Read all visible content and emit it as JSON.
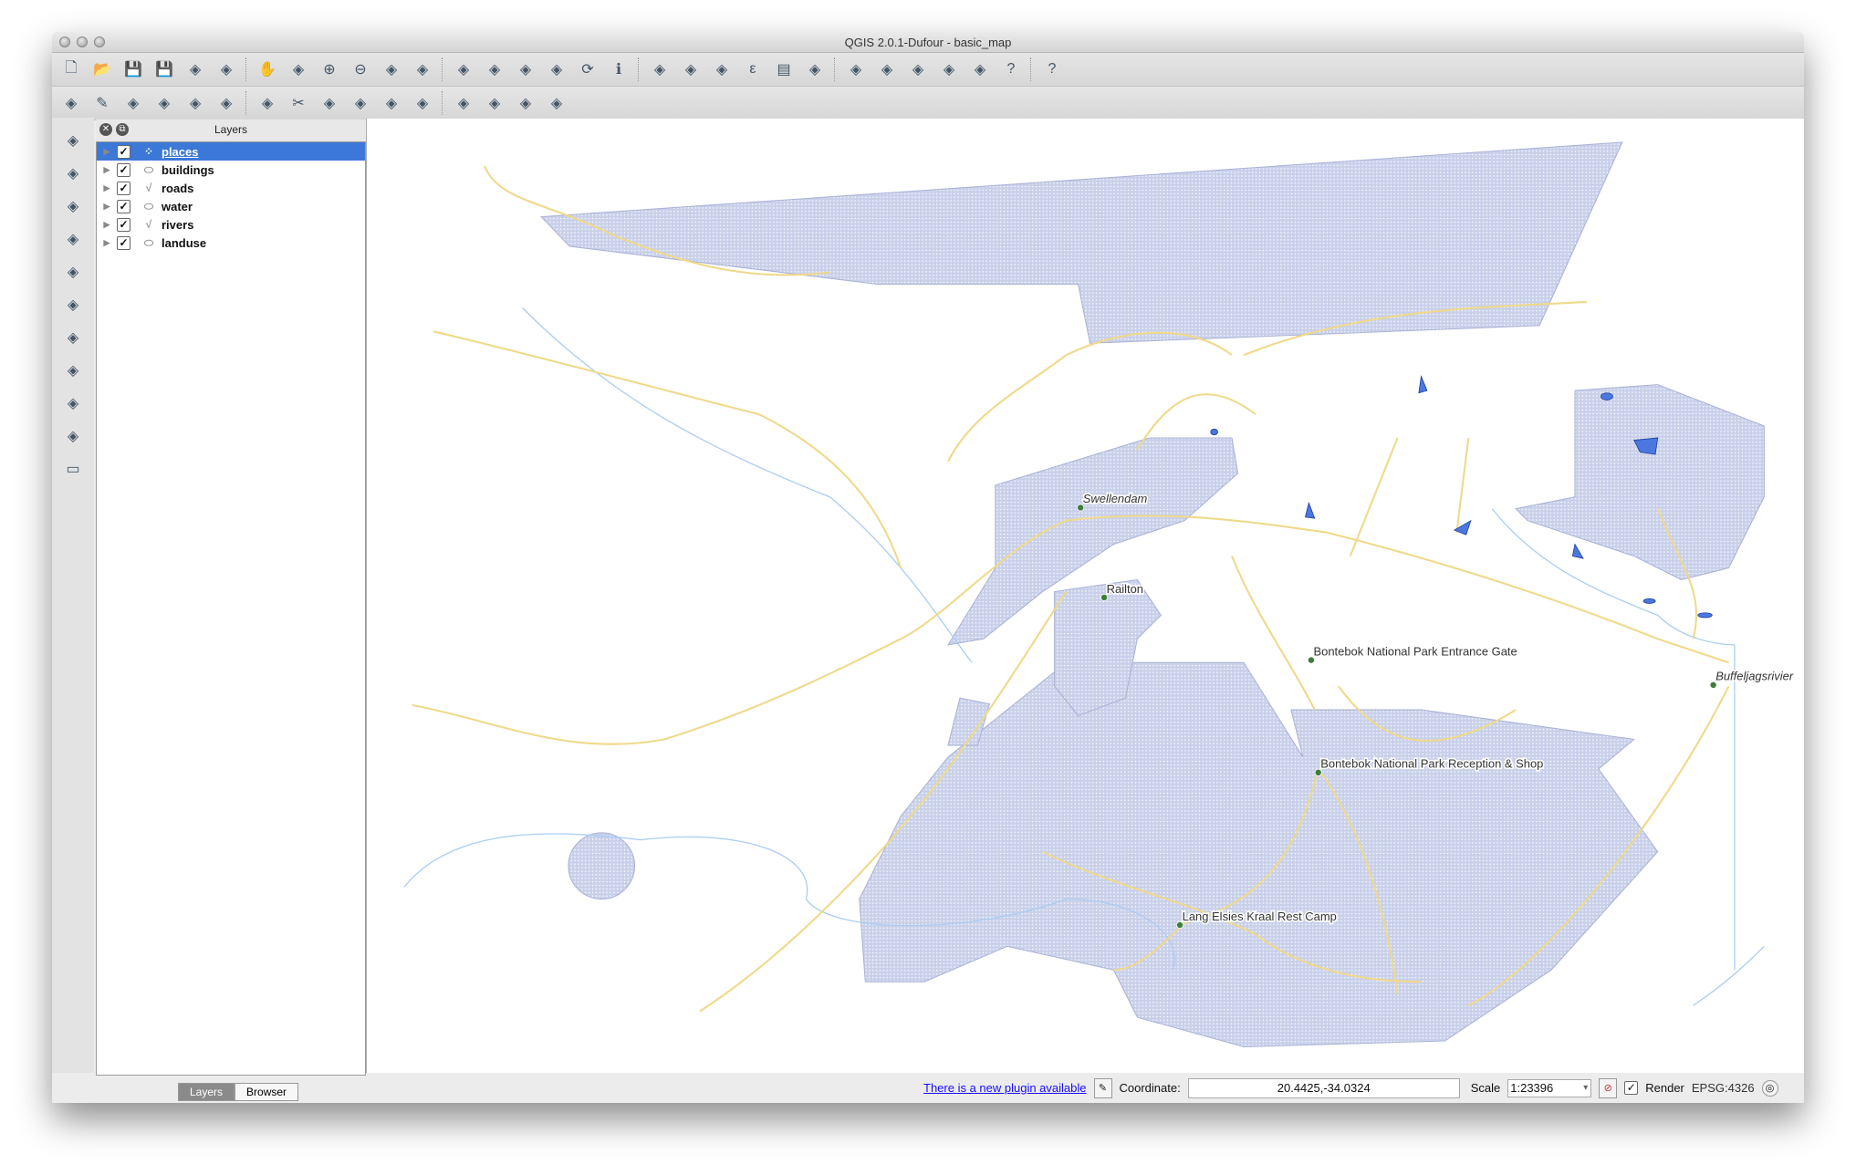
{
  "window": {
    "title": "QGIS 2.0.1-Dufour - basic_map"
  },
  "toolbar1": [
    "new-project",
    "open-project",
    "save-project",
    "save-as",
    "new-print-composer",
    "composer-manager",
    "pan",
    "pan-to-selection",
    "zoom-in",
    "zoom-out",
    "zoom-native",
    "zoom-full",
    "zoom-to-selection",
    "zoom-to-layer",
    "zoom-last",
    "zoom-next",
    "refresh",
    "identify",
    "run-action",
    "select",
    "deselect",
    "field-calculator",
    "attribute-table",
    "statistics",
    "measure",
    "map-tips",
    "new-bookmark",
    "show-bookmarks",
    "text-annotation",
    "help",
    "whats-this"
  ],
  "toolbar2": [
    "current-edits",
    "toggle-editing",
    "save-edits",
    "add-feature",
    "move-feature",
    "node-tool",
    "delete-selected",
    "cut-features",
    "copy-features",
    "paste-features",
    "label-tool",
    "pin-labels",
    "show-hide-labels",
    "move-label",
    "rotate-label",
    "change-label"
  ],
  "left_toolbar": [
    "add-vector-layer",
    "add-raster-layer",
    "add-postgis-layer",
    "add-spatialite-layer",
    "add-mssql-layer",
    "add-wms-layer",
    "add-wcs-layer",
    "add-wfs-layer",
    "add-delimited-text",
    "new-shapefile",
    "remove-layer"
  ],
  "layers_panel": {
    "title": "Layers",
    "layers": [
      {
        "name": "places",
        "visible": true,
        "type": "point",
        "selected": true
      },
      {
        "name": "buildings",
        "visible": true,
        "type": "polygon"
      },
      {
        "name": "roads",
        "visible": true,
        "type": "line"
      },
      {
        "name": "water",
        "visible": true,
        "type": "polygon"
      },
      {
        "name": "rivers",
        "visible": true,
        "type": "line"
      },
      {
        "name": "landuse",
        "visible": true,
        "type": "polygon"
      }
    ],
    "tabs": [
      "Layers",
      "Browser"
    ],
    "active_tab": "Layers"
  },
  "map": {
    "places": [
      "Swellendam",
      "Railton",
      "Bontebok National Park Entrance Gate",
      "Bontebok National Park Reception & Shop",
      "Lang Elsies Kraal Rest Camp",
      "Buffeljagsrivier"
    ],
    "colors": {
      "landuse": "#c9d0ea",
      "roads": "#efd98a",
      "rivers": "#a9cdf2",
      "water": "#4a78e0",
      "places": "#3e7d3c",
      "selection": "#3b78d7"
    }
  },
  "statusbar": {
    "plugin_link": "There is a new plugin available",
    "coordinate_label": "Coordinate:",
    "coordinate_value": "20.4425,-34.0324",
    "scale_label": "Scale",
    "scale_value": "1:23396",
    "render_label": "Render",
    "render_checked": true,
    "crs": "EPSG:4326"
  }
}
